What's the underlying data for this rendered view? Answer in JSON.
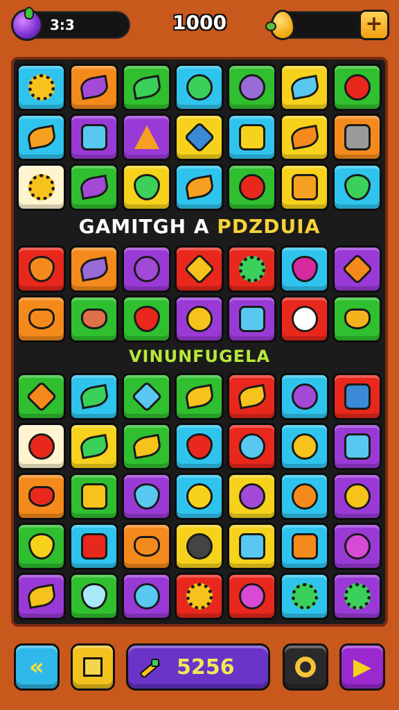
{
  "hud": {
    "moves_text": "3:3",
    "score": "1000",
    "add_label": "+"
  },
  "banners": {
    "first_part_a": "GAMITGH A ",
    "first_part_b": "PDZDUIA",
    "second": "VINUNFUGELA"
  },
  "bottom": {
    "back_glyph": "«",
    "counter": "5256",
    "play_glyph": "▶"
  },
  "colors": {
    "background": "#c8581c",
    "board": "#1b1b1b",
    "cyan": "#2fc4ee",
    "orange": "#f58a1c",
    "green": "#2fbf2f",
    "purple": "#9a3ad6",
    "yellow": "#f6d21c",
    "red": "#e8281c",
    "cream": "#fff4d0"
  },
  "tile_rows": [
    [
      {
        "color": "cyan",
        "shape": "gear",
        "sym": "#f6c21c",
        "icon": "gear-icon"
      },
      {
        "color": "orange",
        "shape": "leaf",
        "sym": "#a24ad6",
        "icon": "leaf-icon"
      },
      {
        "color": "green",
        "shape": "leaf",
        "sym": "#3ad05a",
        "icon": "leaf-icon"
      },
      {
        "color": "cyan",
        "shape": "circle",
        "sym": "#3ad05a",
        "icon": "swirl-icon"
      },
      {
        "color": "green",
        "shape": "circle",
        "sym": "#9a6ad6",
        "icon": "ball-icon"
      },
      {
        "color": "yellow",
        "shape": "leaf",
        "sym": "#58c8f0",
        "icon": "feather-icon"
      },
      {
        "color": "green",
        "shape": "circle",
        "sym": "#e8281c",
        "icon": "button-icon"
      }
    ],
    [
      {
        "color": "cyan",
        "shape": "leaf",
        "sym": "#f5a020",
        "icon": "fleur-icon"
      },
      {
        "color": "purple",
        "shape": "square",
        "sym": "#58c8f0",
        "icon": "camera-icon"
      },
      {
        "color": "purple",
        "shape": "tri",
        "sym": "#f5a020",
        "icon": "cone-icon"
      },
      {
        "color": "yellow",
        "shape": "diamond",
        "sym": "#3a8ad6",
        "icon": "box-icon"
      },
      {
        "color": "cyan",
        "shape": "square",
        "sym": "#f6d21c",
        "icon": "music-note-icon"
      },
      {
        "color": "yellow",
        "shape": "leaf",
        "sym": "#f58a1c",
        "icon": "fish-icon"
      },
      {
        "color": "orange",
        "shape": "square",
        "sym": "#9a9a9a",
        "icon": "safe-icon"
      }
    ],
    [
      {
        "color": "cream",
        "shape": "gear",
        "sym": "#f6c21c",
        "icon": "gear-icon"
      },
      {
        "color": "green",
        "shape": "leaf",
        "sym": "#a24ad6",
        "icon": "leaf-icon"
      },
      {
        "color": "yellow",
        "shape": "drop",
        "sym": "#3ad05a",
        "icon": "slime-icon"
      },
      {
        "color": "cyan",
        "shape": "leaf",
        "sym": "#f5a020",
        "icon": "brush-icon"
      },
      {
        "color": "green",
        "shape": "circle",
        "sym": "#e8281c",
        "icon": "face-icon"
      },
      {
        "color": "yellow",
        "shape": "square",
        "sym": "#f5a020",
        "icon": "smile-block-icon"
      },
      {
        "color": "cyan",
        "shape": "drop",
        "sym": "#3ad05a",
        "icon": "slime-icon"
      }
    ],
    [
      {
        "color": "red",
        "shape": "drop",
        "sym": "#f58a1c",
        "icon": "pot-icon"
      },
      {
        "color": "orange",
        "shape": "leaf",
        "sym": "#9a6ad6",
        "icon": "crystal-icon"
      },
      {
        "color": "purple",
        "shape": "circle",
        "sym": "#a24ad6",
        "icon": "orb-icon"
      },
      {
        "color": "red",
        "shape": "diamond",
        "sym": "#f6c21c",
        "icon": "envelope-icon"
      },
      {
        "color": "red",
        "shape": "gear",
        "sym": "#3ad05a",
        "icon": "blob-icon"
      },
      {
        "color": "cyan",
        "shape": "drop",
        "sym": "#d62aa0",
        "icon": "tool-icon"
      },
      {
        "color": "purple",
        "shape": "diamond",
        "sym": "#f58a1c",
        "icon": "kite-icon"
      }
    ],
    [
      {
        "color": "orange",
        "shape": "bowl",
        "sym": "#f58a1c",
        "icon": "bowl-icon"
      },
      {
        "color": "green",
        "shape": "bowl",
        "sym": "#e0704a",
        "icon": "pot-icon"
      },
      {
        "color": "green",
        "shape": "drop",
        "sym": "#e8281c",
        "icon": "drop-icon"
      },
      {
        "color": "purple",
        "shape": "circle",
        "sym": "#f6c21c",
        "icon": "bulb-icon"
      },
      {
        "color": "purple",
        "shape": "square",
        "sym": "#58c8f0",
        "icon": "box-icon"
      },
      {
        "color": "red",
        "shape": "circle",
        "sym": "#ffffff",
        "icon": "eye-icon"
      },
      {
        "color": "green",
        "shape": "bowl",
        "sym": "#f6b21c",
        "icon": "bag-icon"
      }
    ],
    [
      {
        "color": "green",
        "shape": "diamond",
        "sym": "#f58a1c",
        "icon": "kite-icon"
      },
      {
        "color": "cyan",
        "shape": "leaf",
        "sym": "#3ad05a",
        "icon": "dino-icon"
      },
      {
        "color": "green",
        "shape": "diamond",
        "sym": "#58c8f0",
        "icon": "cube-icon"
      },
      {
        "color": "green",
        "shape": "leaf",
        "sym": "#f6c21c",
        "icon": "lemon-icon"
      },
      {
        "color": "red",
        "shape": "leaf",
        "sym": "#f6c21c",
        "icon": "bow-icon"
      },
      {
        "color": "cyan",
        "shape": "circle",
        "sym": "#a24ad6",
        "icon": "compass-icon"
      },
      {
        "color": "red",
        "shape": "square",
        "sym": "#3a8ad6",
        "icon": "note-icon"
      }
    ],
    [
      {
        "color": "cream",
        "shape": "circle",
        "sym": "#e8281c",
        "icon": "target-icon"
      },
      {
        "color": "yellow",
        "shape": "leaf",
        "sym": "#3ad05a",
        "icon": "leaf-icon"
      },
      {
        "color": "green",
        "shape": "leaf",
        "sym": "#f6c21c",
        "icon": "stick-icon"
      },
      {
        "color": "cyan",
        "shape": "drop",
        "sym": "#e8281c",
        "icon": "pill-icon"
      },
      {
        "color": "red",
        "shape": "circle",
        "sym": "#58c8f0",
        "icon": "chat-icon"
      },
      {
        "color": "cyan",
        "shape": "circle",
        "sym": "#f6c21c",
        "icon": "racket-icon"
      },
      {
        "color": "purple",
        "shape": "square",
        "sym": "#58c8f0",
        "icon": "screen-icon"
      }
    ],
    [
      {
        "color": "orange",
        "shape": "bowl",
        "sym": "#e8281c",
        "icon": "bowl-icon"
      },
      {
        "color": "green",
        "shape": "square",
        "sym": "#f6c21c",
        "icon": "radio-icon"
      },
      {
        "color": "purple",
        "shape": "drop",
        "sym": "#58c8f0",
        "icon": "popsicle-icon"
      },
      {
        "color": "cyan",
        "shape": "circle",
        "sym": "#f6d21c",
        "icon": "chick-icon"
      },
      {
        "color": "yellow",
        "shape": "circle",
        "sym": "#a24ad6",
        "icon": "cat-icon"
      },
      {
        "color": "cyan",
        "shape": "circle",
        "sym": "#f58a1c",
        "icon": "ball-icon"
      },
      {
        "color": "purple",
        "shape": "circle",
        "sym": "#f6c21c",
        "icon": "ring-icon"
      }
    ],
    [
      {
        "color": "green",
        "shape": "drop",
        "sym": "#f6d21c",
        "icon": "banana-icon"
      },
      {
        "color": "cyan",
        "shape": "square",
        "sym": "#e8281c",
        "icon": "phone-icon"
      },
      {
        "color": "orange",
        "shape": "bowl",
        "sym": "#f58a1c",
        "icon": "bowl-icon"
      },
      {
        "color": "yellow",
        "shape": "circle",
        "sym": "#444444",
        "icon": "bomb-icon"
      },
      {
        "color": "yellow",
        "shape": "square",
        "sym": "#58c8f0",
        "icon": "can-icon"
      },
      {
        "color": "cyan",
        "shape": "square",
        "sym": "#f58a1c",
        "icon": "box-icon"
      },
      {
        "color": "purple",
        "shape": "circle",
        "sym": "#d64ad6",
        "icon": "monster-icon"
      }
    ],
    [
      {
        "color": "purple",
        "shape": "leaf",
        "sym": "#f6c21c",
        "icon": "lemon-icon"
      },
      {
        "color": "green",
        "shape": "drop",
        "sym": "#a8e8f8",
        "icon": "ghost-icon"
      },
      {
        "color": "purple",
        "shape": "circle",
        "sym": "#58c8f0",
        "icon": "blob-icon"
      },
      {
        "color": "red",
        "shape": "gear",
        "sym": "#f6c21c",
        "icon": "gear-icon"
      },
      {
        "color": "red",
        "shape": "circle",
        "sym": "#d64ad6",
        "icon": "monster-icon"
      },
      {
        "color": "cyan",
        "shape": "gear",
        "sym": "#3ad05a",
        "icon": "flower-icon"
      },
      {
        "color": "purple",
        "shape": "gear",
        "sym": "#3ad05a",
        "icon": "gear-icon"
      }
    ]
  ]
}
